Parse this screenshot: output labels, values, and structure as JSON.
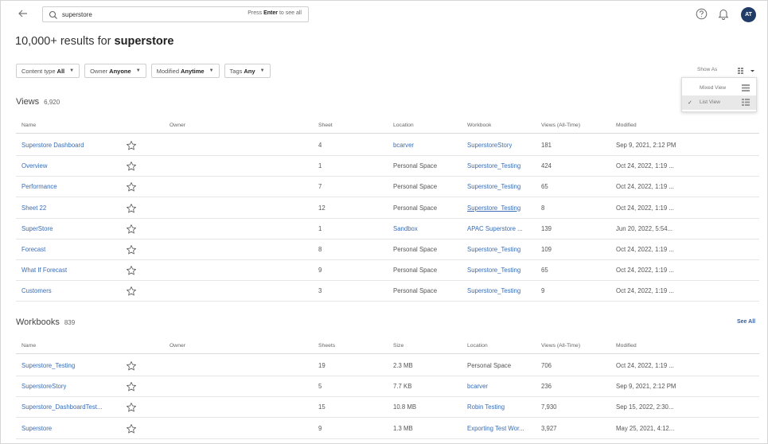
{
  "search": {
    "value": "superstore",
    "hint_prefix": "Press",
    "hint_key": "Enter",
    "hint_suffix": "to see all"
  },
  "user": {
    "initials": "AT"
  },
  "title": {
    "prefix": "10,000+ results for",
    "query": "superstore"
  },
  "filters": [
    {
      "label": "Content type",
      "value": "All"
    },
    {
      "label": "Owner",
      "value": "Anyone"
    },
    {
      "label": "Modified",
      "value": "Anytime"
    },
    {
      "label": "Tags",
      "value": "Any"
    }
  ],
  "show_as": {
    "label": "Show As",
    "options": [
      {
        "label": "Mixed View",
        "selected": false
      },
      {
        "label": "List View",
        "selected": true
      }
    ]
  },
  "views": {
    "title": "Views",
    "count": "6,920",
    "columns": [
      "Name",
      "Owner",
      "Sheet",
      "Location",
      "Workbook",
      "Views (All-Time)",
      "Modified"
    ],
    "rows": [
      {
        "name": "Superstore Dashboard",
        "owner": "",
        "sheet": "4",
        "location": "bcarver",
        "location_link": true,
        "workbook": "SuperstoreStory",
        "views": "181",
        "modified": "Sep 9, 2021, 2:12 PM"
      },
      {
        "name": "Overview",
        "owner": "",
        "sheet": "1",
        "location": "Personal Space",
        "location_link": false,
        "workbook": "Superstore_Testing",
        "views": "424",
        "modified": "Oct 24, 2022, 1:19 ..."
      },
      {
        "name": "Performance",
        "owner": "",
        "sheet": "7",
        "location": "Personal Space",
        "location_link": false,
        "workbook": "Superstore_Testing",
        "views": "65",
        "modified": "Oct 24, 2022, 1:19 ..."
      },
      {
        "name": "Sheet 22",
        "owner": "",
        "sheet": "12",
        "location": "Personal Space",
        "location_link": false,
        "workbook": "Superstore_Testing",
        "views": "8",
        "modified": "Oct 24, 2022, 1:19 ...",
        "workbook_underline": true
      },
      {
        "name": "SuperStore",
        "owner": "",
        "sheet": "1",
        "location": "Sandbox",
        "location_link": true,
        "workbook": "APAC Superstore ...",
        "views": "139",
        "modified": "Jun 20, 2022, 5:54..."
      },
      {
        "name": "Forecast",
        "owner": "",
        "sheet": "8",
        "location": "Personal Space",
        "location_link": false,
        "workbook": "Superstore_Testing",
        "views": "109",
        "modified": "Oct 24, 2022, 1:19 ..."
      },
      {
        "name": "What If Forecast",
        "owner": "",
        "sheet": "9",
        "location": "Personal Space",
        "location_link": false,
        "workbook": "Superstore_Testing",
        "views": "65",
        "modified": "Oct 24, 2022, 1:19 ..."
      },
      {
        "name": "Customers",
        "owner": "",
        "sheet": "3",
        "location": "Personal Space",
        "location_link": false,
        "workbook": "Superstore_Testing",
        "views": "9",
        "modified": "Oct 24, 2022, 1:19 ..."
      }
    ]
  },
  "workbooks": {
    "title": "Workbooks",
    "count": "839",
    "see_all": "See All",
    "columns": [
      "Name",
      "Owner",
      "Sheets",
      "Size",
      "Location",
      "Views (All-Time)",
      "Modified"
    ],
    "rows": [
      {
        "name": "Superstore_Testing",
        "owner": "",
        "sheets": "19",
        "size": "2.3 MB",
        "location": "Personal Space",
        "location_link": false,
        "views": "706",
        "modified": "Oct 24, 2022, 1:19 ..."
      },
      {
        "name": "SuperstoreStory",
        "owner": "",
        "sheets": "5",
        "size": "7.7 KB",
        "location": "bcarver",
        "location_link": true,
        "views": "236",
        "modified": "Sep 9, 2021, 2:12 PM"
      },
      {
        "name": "Superstore_DashboardTest...",
        "owner": "",
        "sheets": "15",
        "size": "10.8 MB",
        "location": "Robin Testing",
        "location_link": true,
        "views": "7,930",
        "modified": "Sep 15, 2022, 2:30..."
      },
      {
        "name": "Superstore",
        "owner": "",
        "sheets": "9",
        "size": "1.3 MB",
        "location": "Exporting Test Wor...",
        "location_link": true,
        "views": "3,927",
        "modified": "May 25, 2021, 4:12..."
      }
    ]
  },
  "colors": {
    "link": "#3a6db5",
    "avatar": "#1f3b66"
  }
}
